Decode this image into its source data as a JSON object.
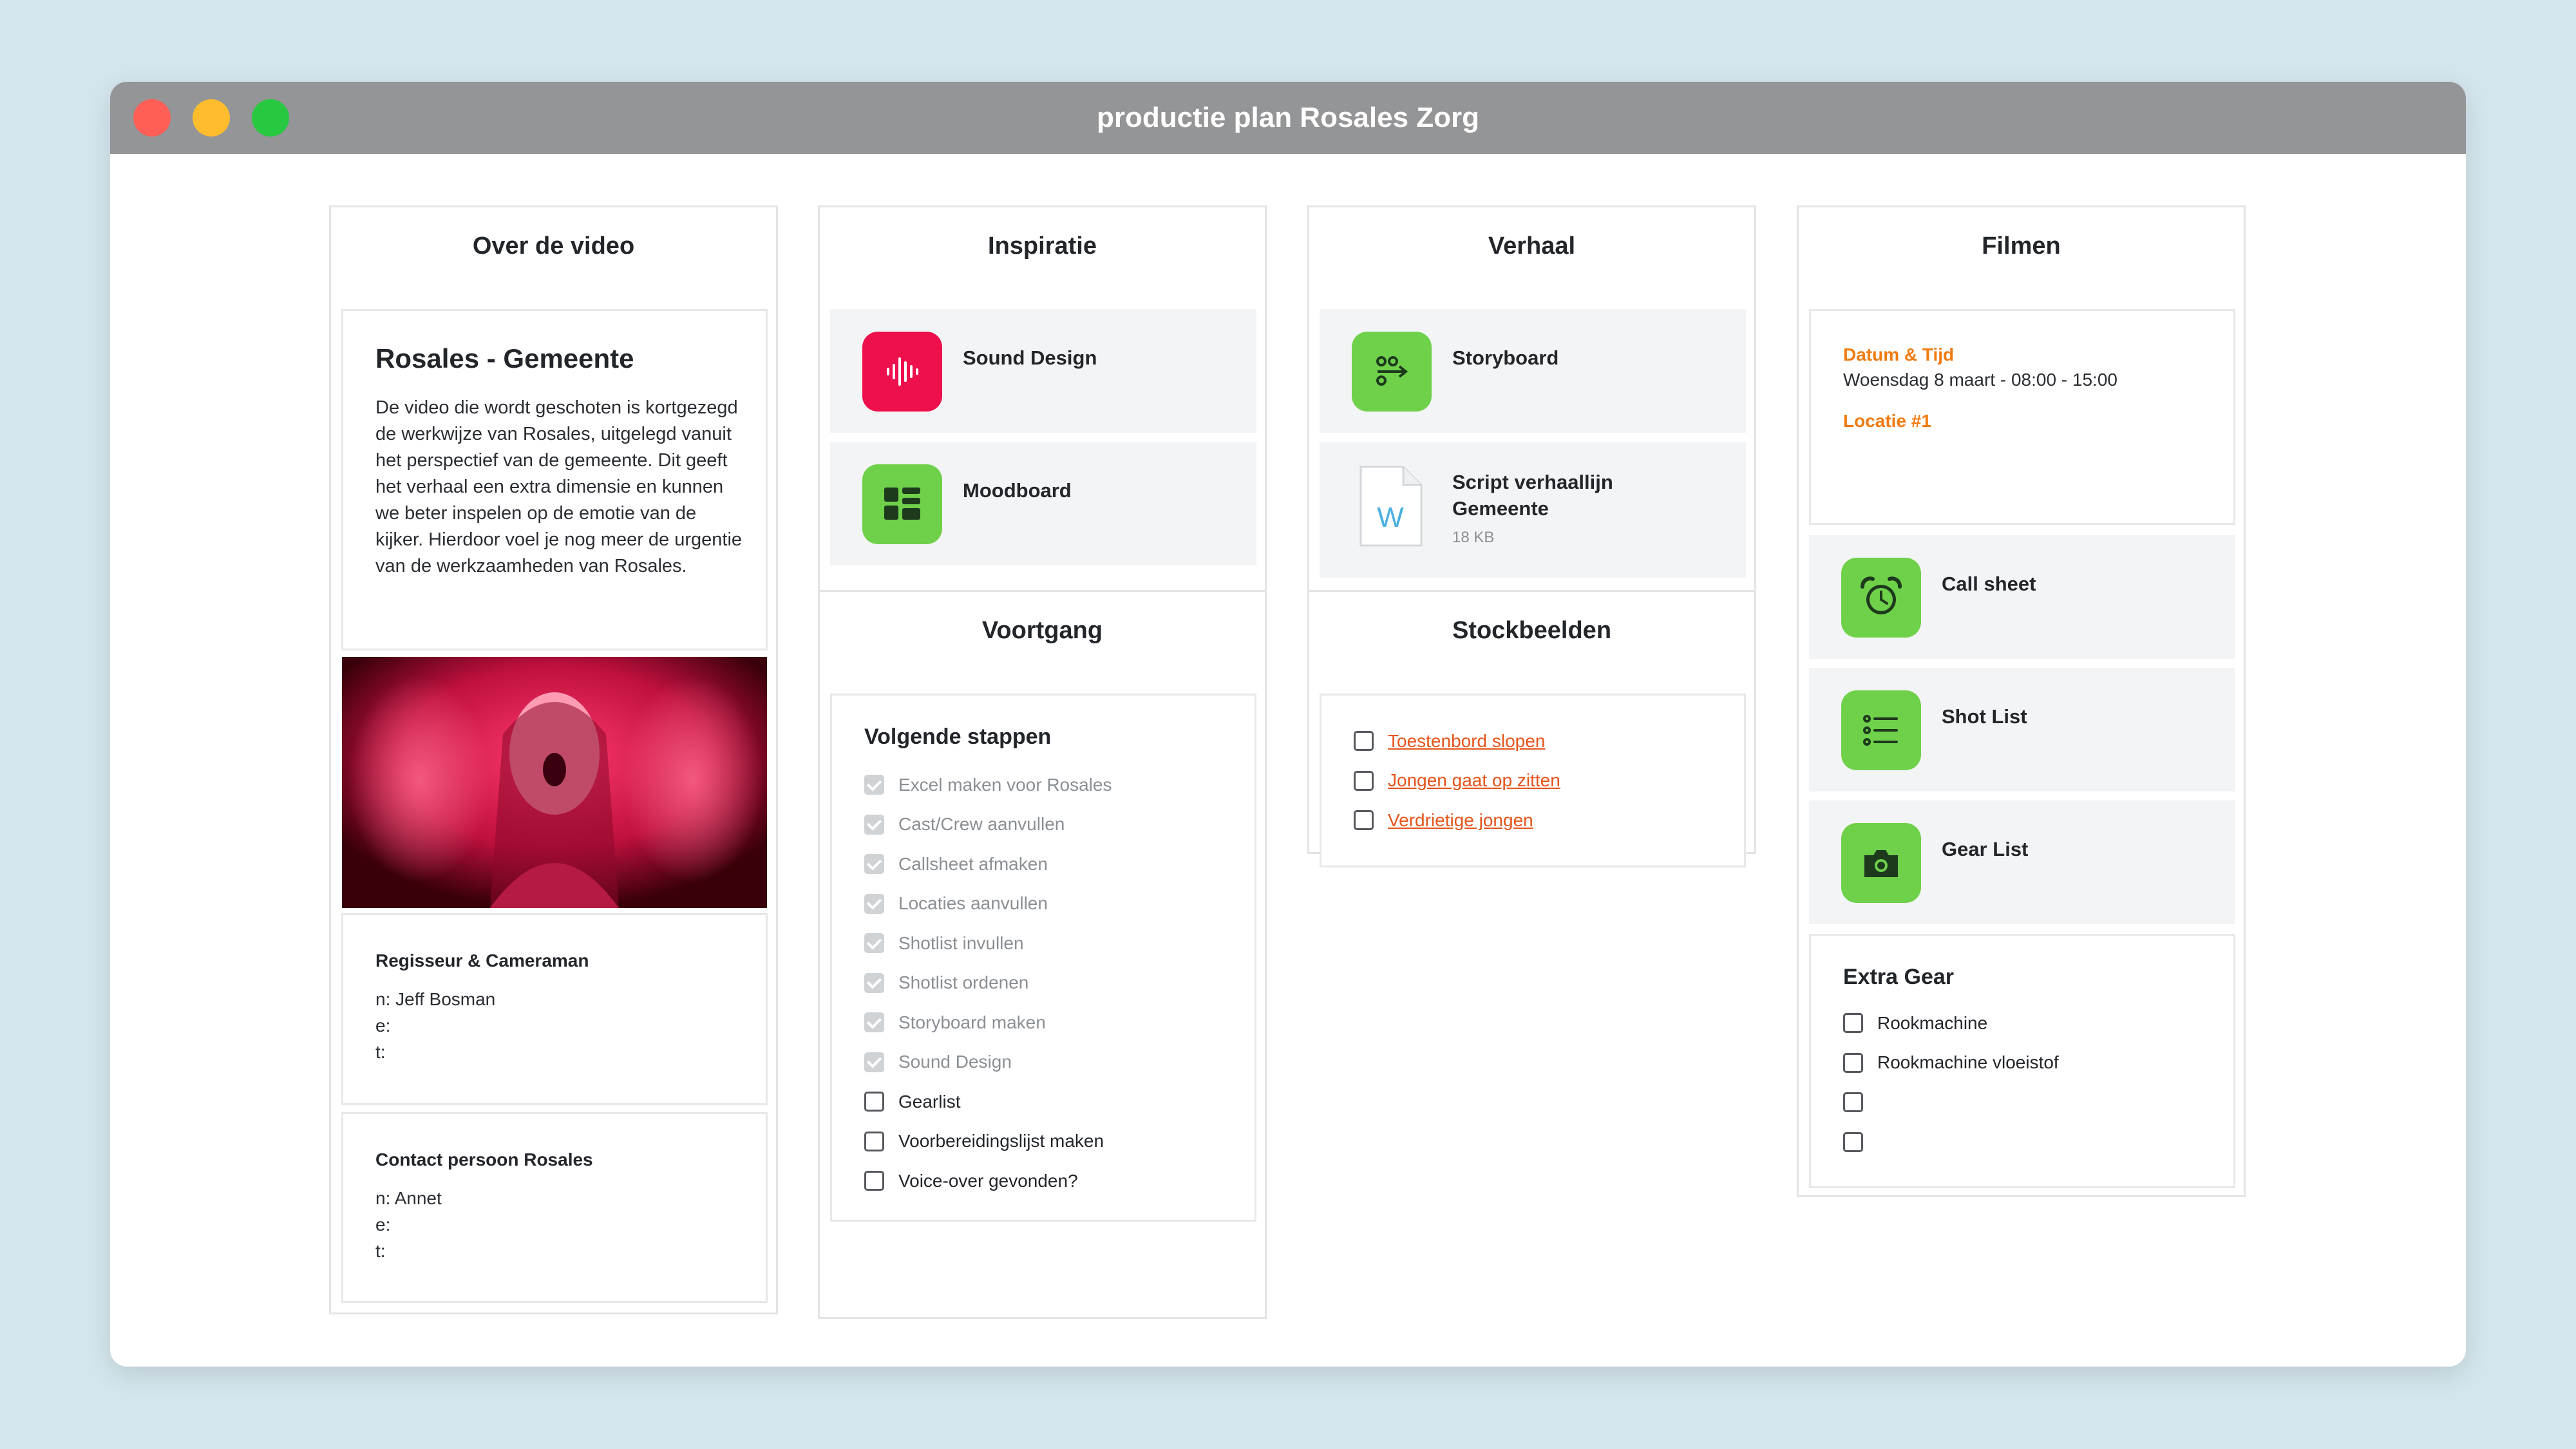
{
  "window": {
    "title": "productie plan Rosales Zorg"
  },
  "columns": {
    "over": {
      "title": "Over de video",
      "card_title": "Rosales - Gemeente",
      "description": "De video die wordt geschoten is kortgezegd de werkwijze van Rosales, uitgelegd vanuit het perspectief van de gemeente. Dit geeft het verhaal een extra dimensie en kunnen we beter inspelen op de emotie van de kijker. Hierdoor voel je nog meer de urgentie van de werkzaamheden van Rosales.",
      "contacts": [
        {
          "role": "Regisseur & Cameraman",
          "n": "n: Jeff Bosman",
          "e": "e:",
          "t": "t:"
        },
        {
          "role": "Contact persoon Rosales",
          "n": "n: Annet",
          "e": "e:",
          "t": "t:"
        }
      ]
    },
    "inspiratie": {
      "title": "Inspiratie",
      "items": [
        {
          "label": "Sound Design",
          "icon": "waveform-icon"
        },
        {
          "label": "Moodboard",
          "icon": "moodboard-icon"
        }
      ]
    },
    "voortgang": {
      "title": "Voortgang",
      "card_title": "Volgende stappen",
      "steps": [
        {
          "label": "Excel maken voor Rosales",
          "done": true
        },
        {
          "label": "Cast/Crew aanvullen",
          "done": true
        },
        {
          "label": "Callsheet afmaken",
          "done": true
        },
        {
          "label": "Locaties aanvullen",
          "done": true
        },
        {
          "label": "Shotlist invullen",
          "done": true
        },
        {
          "label": "Shotlist ordenen",
          "done": true
        },
        {
          "label": "Storyboard maken",
          "done": true
        },
        {
          "label": "Sound Design",
          "done": true
        },
        {
          "label": "Gearlist",
          "done": false
        },
        {
          "label": "Voorbereidingslijst maken",
          "done": false
        },
        {
          "label": "Voice-over gevonden?",
          "done": false
        }
      ]
    },
    "verhaal": {
      "title": "Verhaal",
      "storyboard_label": "Storyboard",
      "script_title_line1": "Script verhaallijn",
      "script_title_line2": "Gemeente",
      "script_size": "18 KB",
      "script_icon_letter": "W"
    },
    "stockbeelden": {
      "title": "Stockbeelden",
      "links": [
        "Toestenbord slopen",
        "Jongen gaat op zitten",
        "Verdrietige jongen"
      ]
    },
    "filmen": {
      "title": "Filmen",
      "datum_label": "Datum & Tijd",
      "datum_value": "Woensdag 8 maart - 08:00 - 15:00",
      "locatie_label": "Locatie #1",
      "items": [
        {
          "label": "Call sheet",
          "icon": "alarm-clock-icon"
        },
        {
          "label": "Shot List",
          "icon": "list-icon"
        },
        {
          "label": "Gear List",
          "icon": "camera-icon"
        }
      ],
      "extra_gear_title": "Extra Gear",
      "extra_gear": [
        "Rookmachine",
        "Rookmachine vloeistof",
        "",
        ""
      ]
    }
  },
  "colors": {
    "background": "#d4e6ed",
    "titlebar": "#939597",
    "green": "#6fd14a",
    "red": "#ee0f4d",
    "orange": "#f07b10",
    "link": "#e5541a"
  }
}
